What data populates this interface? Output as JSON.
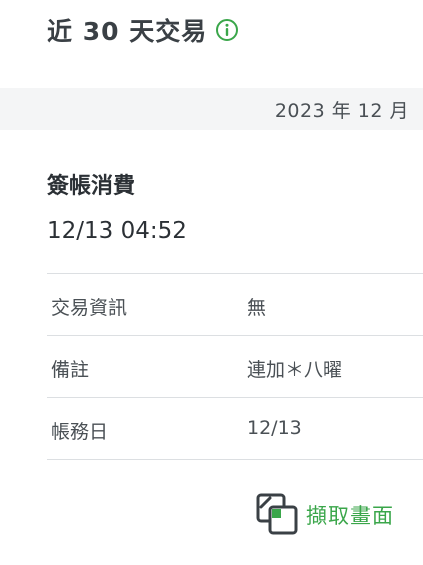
{
  "header": {
    "title": "近 30 天交易",
    "info_icon": "info-circle-icon"
  },
  "period": {
    "label": "2023 年 12 月"
  },
  "transaction": {
    "type": "簽帳消費",
    "datetime": "12/13 04:52",
    "details": [
      {
        "label": "交易資訊",
        "value": "無"
      },
      {
        "label": "備註",
        "value": "連加＊八曜"
      },
      {
        "label": "帳務日",
        "value": "12/13"
      }
    ]
  },
  "actions": {
    "capture_label": "擷取畫面",
    "capture_icon": "screenshot-icon"
  },
  "colors": {
    "accent_green": "#3aa64a",
    "text_dark": "#2f3438",
    "divider": "#dcdfe2",
    "band_background": "#f4f5f6"
  }
}
